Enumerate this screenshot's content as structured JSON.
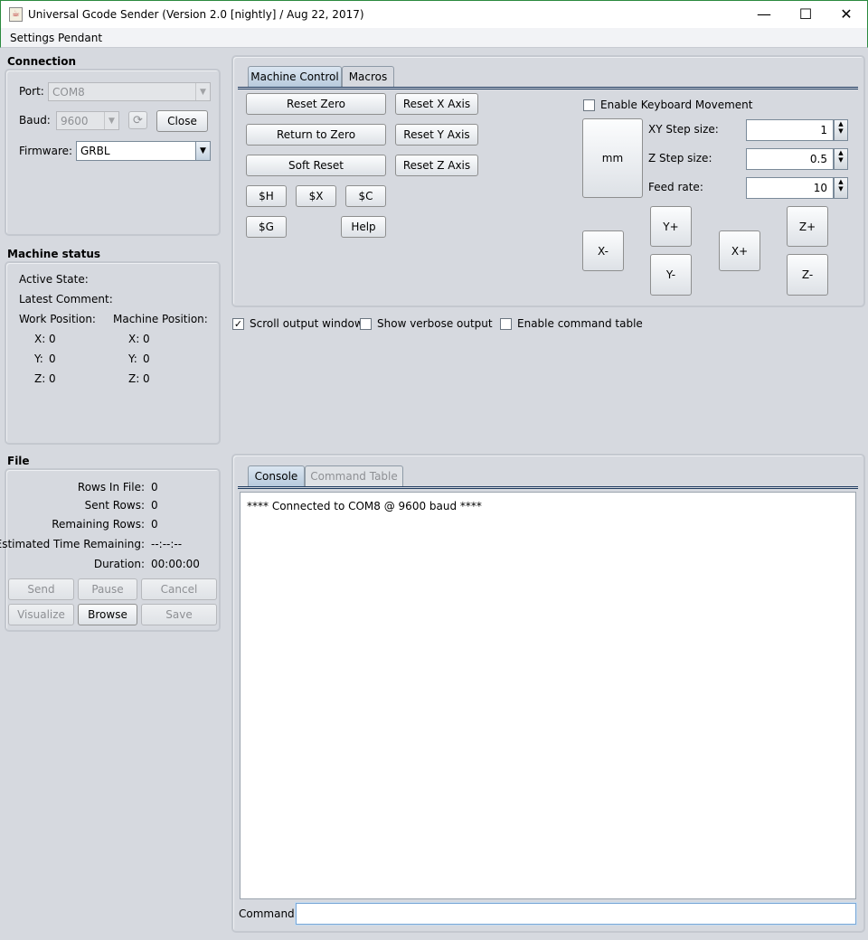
{
  "window": {
    "title": "Universal Gcode Sender (Version 2.0 [nightly]  / Aug 22, 2017)",
    "app_icon": "java-cup-icon",
    "minimize": "—",
    "maximize": "☐",
    "close": "✕"
  },
  "menu": {
    "settings": "Settings",
    "pendant": "Pendant"
  },
  "connection": {
    "title": "Connection",
    "port_label": "Port:",
    "port_value": "COM8",
    "baud_label": "Baud:",
    "baud_value": "9600",
    "refresh_icon": "refresh-icon",
    "close_button": "Close",
    "firmware_label": "Firmware:",
    "firmware_value": "GRBL"
  },
  "machine_status": {
    "title": "Machine status",
    "active_state": "Active State:",
    "latest_comment": "Latest Comment:",
    "work_position": "Work Position:",
    "machine_position": "Machine Position:",
    "work": {
      "x_label": "X:",
      "x": "0",
      "y_label": "Y:",
      "y": "0",
      "z_label": "Z:",
      "z": "0"
    },
    "machine": {
      "x_label": "X:",
      "x": "0",
      "y_label": "Y:",
      "y": "0",
      "z_label": "Z:",
      "z": "0"
    }
  },
  "file": {
    "title": "File",
    "rows_in_file_label": "Rows In File:",
    "rows_in_file": "0",
    "sent_rows_label": "Sent Rows:",
    "sent_rows": "0",
    "remaining_rows_label": "Remaining Rows:",
    "remaining_rows": "0",
    "time_remaining_label": "Estimated Time Remaining:",
    "time_remaining": "--:--:--",
    "duration_label": "Duration:",
    "duration": "00:00:00",
    "buttons": {
      "send": "Send",
      "pause": "Pause",
      "cancel": "Cancel",
      "visualize": "Visualize",
      "browse": "Browse",
      "save": "Save"
    }
  },
  "control": {
    "tabs": {
      "machine_control": "Machine Control",
      "macros": "Macros"
    },
    "reset_zero": "Reset Zero",
    "return_to_zero": "Return to Zero",
    "soft_reset": "Soft Reset",
    "reset_x": "Reset X Axis",
    "reset_y": "Reset Y Axis",
    "reset_z": "Reset Z Axis",
    "home": "$H",
    "unlock": "$X",
    "check": "$C",
    "gcode_state": "$G",
    "help": "Help",
    "keyboard_movement": "Enable Keyboard Movement",
    "units": "mm",
    "xy_step_label": "XY Step size:",
    "xy_step": "1",
    "z_step_label": "Z Step size:",
    "z_step": "0.5",
    "feed_rate_label": "Feed rate:",
    "feed_rate": "10",
    "jog": {
      "x_minus": "X-",
      "x_plus": "X+",
      "y_plus": "Y+",
      "y_minus": "Y-",
      "z_plus": "Z+",
      "z_minus": "Z-"
    }
  },
  "options": {
    "scroll_output": "Scroll output window",
    "verbose_output": "Show verbose output",
    "command_table": "Enable command table",
    "scroll_checked": "✓"
  },
  "console": {
    "tabs": {
      "console": "Console",
      "command_table": "Command Table"
    },
    "output": "**** Connected to COM8 @ 9600 baud ****",
    "command_label": "Command:",
    "command_value": ""
  }
}
